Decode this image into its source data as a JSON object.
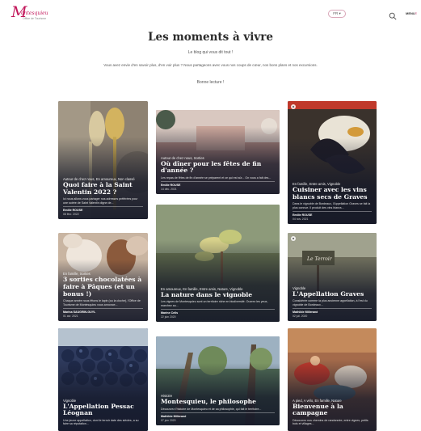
{
  "header": {
    "logo_letter": "M",
    "logo_name": "ontesquieu",
    "logo_sub": "Office de Tourisme",
    "lang_label": "FR ▾",
    "menu_label": "MENU",
    "menu_mark": "≡"
  },
  "intro": {
    "title": "Les moments à vivre",
    "subtitle": "Le blog qui vous dit tout !",
    "text": "Vous avez envie d'en savoir plus, d'en voir plus ? Nous partageons avec vous nos coups de cœur, nos bons plans et nos excursions.",
    "greeting": "Bonne lecture !"
  },
  "cards": [
    {
      "id": "c1",
      "cats": "Autour de chez nous, En amoureux, Non classé",
      "title": "Quoi faire à la Saint Valentin 2022 ?",
      "excerpt": "Ici nous allons vous partager nos adresses préférées pour une soirée de Saint Valentin digne de...",
      "author": "Emilie ROUSE",
      "date": "08 févr. 2022",
      "bg": "#8a7e6c"
    },
    {
      "id": "c2",
      "cats": "Autour de chez nous, Sorties",
      "title": "Où dîner pour les fêtes de fin d'année ?",
      "excerpt": "Les repas de fêtes de fin d'année se préparent et ce qui est sûr... On vous a fait des...",
      "author": "Emilie ROUSE",
      "date": "14 déc. 2021",
      "bg": "#9a6a60"
    },
    {
      "id": "c3",
      "cats": "En famille, Entre amis, Vignoble",
      "title": "Cuisiner avec les vins blancs secs de Graves",
      "excerpt": "Dans le vignoble de Bordeaux, l'Appellation Graves se fait la plus connue. Il produit des vins blancs...",
      "author": "Emilie ROUSE",
      "date": "04 nov. 2021",
      "bg": "#3b3530"
    },
    {
      "id": "c4",
      "cats": "En famille, Sorties",
      "title": "3 sorties chocolatées à faire à Pâques (et un bonus !)",
      "excerpt": "Chaque année nous fêtons le lapin (ou la cloche), l'Office de Tourisme de Montesquieu vous annonce...",
      "author": "Marina SAUGRIN-GUYL",
      "date": "01 avr. 2021",
      "bg": "#b9a393"
    },
    {
      "id": "c5",
      "cats": "En amoureux, En famille, Entre amis, Nature, Vignoble",
      "title": "La nature dans le vignoble",
      "excerpt": "Les vignes de Montesquieu sont un territoire riche en biodiversité. Ouvrez les yeux, marchez au...",
      "author": "Marine Celis",
      "date": "22 juin 2020",
      "bg": "#6c7a4d"
    },
    {
      "id": "c6",
      "cats": "Vignoble",
      "title": "L'Appellation Graves",
      "excerpt": "Considérée comme la plus ancienne appellation, à l'est du vignoble de Bordeaux...",
      "author": "Mathilde Millerand",
      "date": "02 juil. 2020",
      "bg": "#6a6a58"
    },
    {
      "id": "c7",
      "cats": "Vignoble",
      "title": "L'Appellation Pessac Léognan",
      "excerpt": "Une jeune appellation, dont le terroir date des siècles, a su faire sa réputation...",
      "author": "",
      "date": "",
      "bg": "#2e3c63"
    },
    {
      "id": "c8",
      "cats": "Histoire",
      "title": "Montesquieu, le philosophe",
      "excerpt": "Découvrez l'histoire de Montesquieu et de sa philosophie, qui fait le territoire...",
      "author": "Mathilde Millerand",
      "date": "07 juin 2020",
      "bg": "#4d6a55"
    },
    {
      "id": "c9",
      "cats": "A pied, A vélo, En famille, Nature",
      "title": "Bienvenue à la campagne",
      "excerpt": "Découvrez nos chemins de randonnée, entre vignes, petits bois et villages...",
      "author": "",
      "date": "",
      "bg": "#a66a4c"
    }
  ]
}
